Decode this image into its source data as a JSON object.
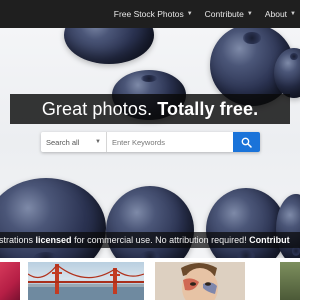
{
  "nav": {
    "items": [
      {
        "label": "Free Stock Photos",
        "chevron": "chevron-down-icon"
      },
      {
        "label": "Contribute",
        "chevron": "chevron-down-icon"
      },
      {
        "label": "About",
        "chevron": "chevron-down-icon"
      }
    ]
  },
  "hero": {
    "headline_regular": "Great photos.",
    "headline_bold": "Totally free."
  },
  "search": {
    "category_label": "Search all",
    "category_icon": "chevron-down-icon",
    "placeholder": "Enter Keywords",
    "button_icon": "search-icon",
    "accent_color": "#1a73d9"
  },
  "tagline": {
    "part1": "ustrations ",
    "part2_bold": "licensed",
    "part3": " for commercial use. No attribution required! ",
    "part4_bold": "Contribut"
  },
  "colors": {
    "nav_bg": "#1f1f1f",
    "band_bg": "#0a0a0a",
    "berry": "#2b3352"
  }
}
